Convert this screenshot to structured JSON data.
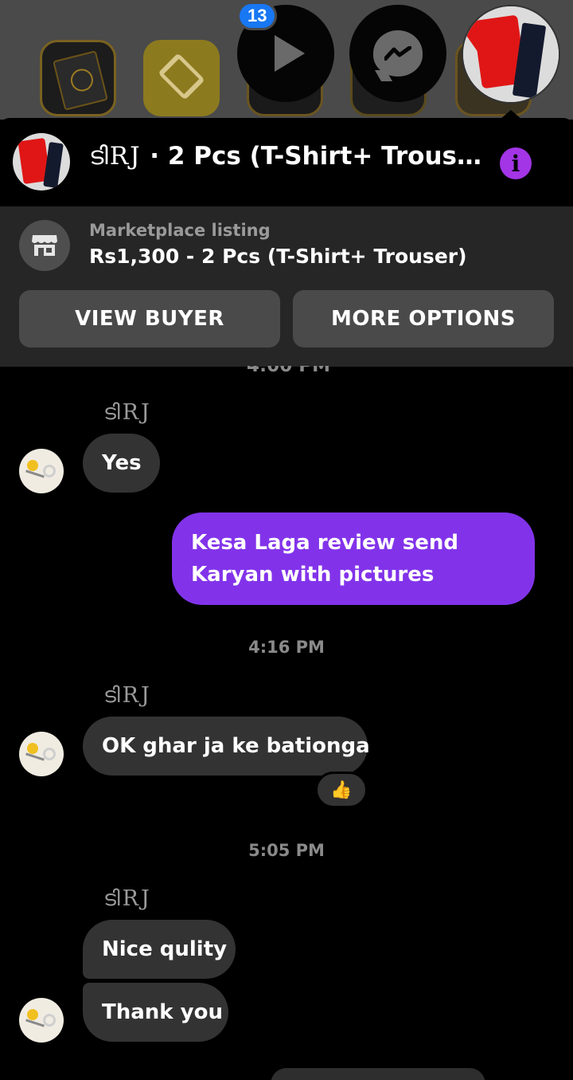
{
  "overlay": {
    "notification_count": "13",
    "icons": [
      "quran-app-icon",
      "gem-app-icon",
      "dark-app-icon",
      "dark-app-icon",
      "dark-app-icon",
      "play-icon",
      "messenger-icon"
    ]
  },
  "header": {
    "contact_name": "ടിRJ",
    "separator": " · ",
    "listing_title": "2 Pcs (T-Shirt+ Trouser)",
    "info_glyph": "i"
  },
  "marketplace": {
    "label": "Marketplace listing",
    "price": "Rs1,300",
    "dash": " - ",
    "item": "2 Pcs (T-Shirt+ Trouser)",
    "view_buyer": "VIEW BUYER",
    "more_options": "MORE OPTIONS"
  },
  "conversation": {
    "cut_timestamp": "4:00 PM",
    "messages": [
      {
        "sender": "ടിRJ",
        "text": "Yes"
      },
      {
        "text": "Kesa Laga review send Karyan with pictures"
      },
      {
        "timestamp": "4:16 PM",
        "sender": "ടിRJ",
        "text": "OK ghar ja ke bationga",
        "reaction": "👍"
      },
      {
        "timestamp": "5:05 PM",
        "sender": "ടിRJ",
        "text": "Nice qulity"
      },
      {
        "text": "Thank you"
      }
    ]
  },
  "colors": {
    "background": "#000000",
    "incoming_bubble": "#333333",
    "outgoing_bubble": "#8233ea",
    "info_button": "#a335e6",
    "badge": "#1877f2",
    "banner": "#262626"
  }
}
